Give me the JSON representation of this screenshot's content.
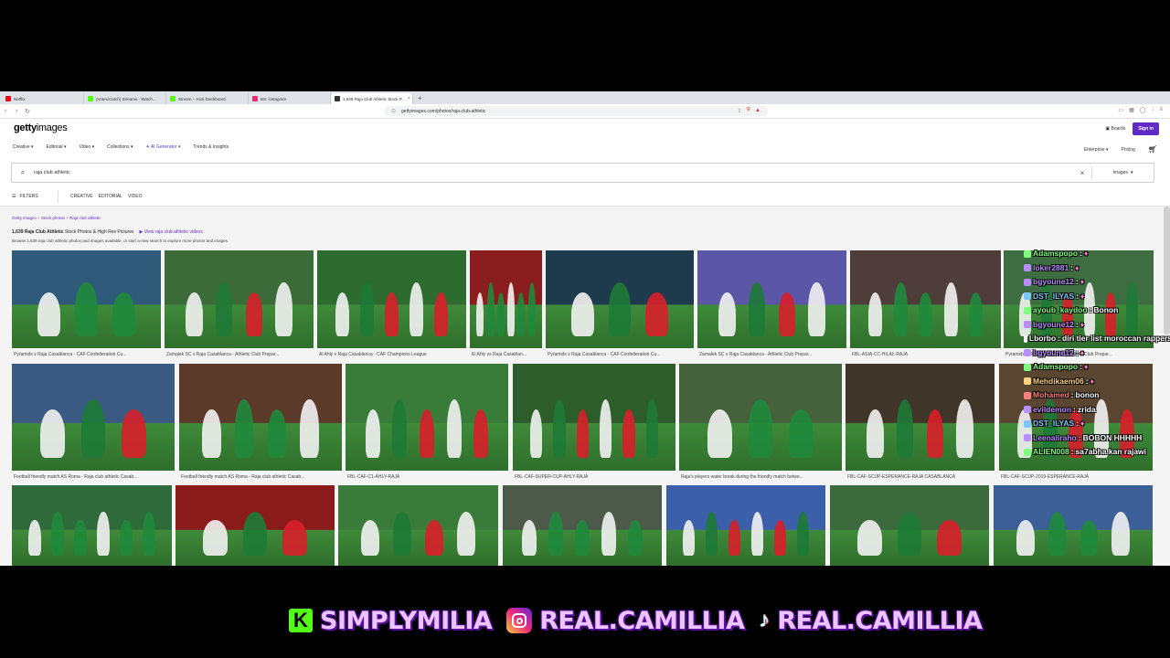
{
  "browser": {
    "tabs": [
      {
        "label": "Netflix",
        "color": "#e50914",
        "active": false
      },
      {
        "label": "(Votes/Catch) Streams - Watch...",
        "color": "#53fc18",
        "active": false
      },
      {
        "label": "Stream -- Kick Dashboard",
        "color": "#53fc18",
        "active": false
      },
      {
        "label": "BS: instagram",
        "color": "#e1306c",
        "active": false
      },
      {
        "label": "1,639 Raja Club Athletic Stock P...",
        "color": "#333333",
        "active": true
      }
    ],
    "url": "gettyimages.com/photos/raja-club-athletic"
  },
  "header": {
    "logo_bold": "getty",
    "logo_rest": "images",
    "nav": [
      "Creative",
      "Editorial",
      "Video",
      "Collections",
      "AI Generator",
      "Trends & Insights"
    ],
    "boards": "Boards",
    "signin": "Sign in",
    "enterprise": "Enterprise",
    "pricing": "Pricing"
  },
  "search": {
    "value": "raja club athletic",
    "scope": "Images"
  },
  "filters": {
    "label": "FILTERS",
    "tabs": [
      "CREATIVE",
      "EDITORIAL",
      "VIDEO"
    ]
  },
  "results": {
    "breadcrumb": [
      "Getty Images",
      "Stock photos",
      "Raja club athletic"
    ],
    "title_bold": "1,639 Raja Club Athletic",
    "title_rest": "Stock Photos & High Res Pictures",
    "video_link": "View raja club athletic videos",
    "subtitle": "Browse 1,639 raja club athletic photos and images available, or start a new search to explore more photos and images."
  },
  "images": [
    {
      "caption": "Pyramids v Raja Casablanca - CAF Confederation Cu...",
      "bg": "#2f5a7a"
    },
    {
      "caption": "Zamalek SC v Raja Casablanca - Athletic Club Prepar...",
      "bg": "#3c6b3a"
    },
    {
      "caption": "Al Ahly v Raja Casablanca - CAF Champions League",
      "bg": "#2e6b2f"
    },
    {
      "caption": "El Ahly vs Raja Casablan...",
      "bg": "#8a1d1d"
    },
    {
      "caption": "Pyramids v Raja Casablanca - CAF Confederation Cu...",
      "bg": "#1e3a4d"
    },
    {
      "caption": "Zamalek SC v Raja Casablanca - Athletic Club Prepar...",
      "bg": "#5b56a6"
    },
    {
      "caption": "FBL-ASIA-CC-HILAL-RAJA",
      "bg": "#4e3d3a"
    },
    {
      "caption": "Pyramids v Raja Casablanca - Athletic Club Prepar...",
      "bg": "#3e6d42"
    },
    {
      "caption": "Football friendly match AS Roma - Raja club athletic Casab...",
      "bg": "#3a5a82"
    },
    {
      "caption": "Football friendly match AS Roma - Raja club athletic Casab...",
      "bg": "#5b3a2a"
    },
    {
      "caption": "FBL-CAF-C1-AHLY-RAJA",
      "bg": "#397c3a"
    },
    {
      "caption": "FBL-CAF-SUPER-CUP-AHLY-RAJA",
      "bg": "#2d5d2a"
    },
    {
      "caption": "Raja's players water break during the friendly match betwe...",
      "bg": "#45623d"
    },
    {
      "caption": "FBL-CAF-SCUP-ESPERANCE-RAJA CASABLANCA",
      "bg": "#3f3528"
    },
    {
      "caption": "FBL-CAF-SCUP-2019-ESPERANCE-RAJA",
      "bg": "#5a4530"
    },
    {
      "caption": "",
      "bg": "#2f6a3a"
    },
    {
      "caption": "",
      "bg": "#8b1a1a"
    },
    {
      "caption": "",
      "bg": "#3a7a3a"
    },
    {
      "caption": "",
      "bg": "#4d5a4a"
    },
    {
      "caption": "",
      "bg": "#3b5fa8"
    },
    {
      "caption": "",
      "bg": "#3d6a3c"
    },
    {
      "caption": "",
      "bg": "#3b5f96"
    }
  ],
  "chat": [
    {
      "user": "Adamspopo",
      "text": "",
      "color": "#7fff7f"
    },
    {
      "user": "loker2881",
      "text": "",
      "color": "#b98cff"
    },
    {
      "user": "bgyoune12",
      "text": "",
      "color": "#b98cff"
    },
    {
      "user": "DST_ILYAS",
      "text": "",
      "color": "#7fc6ff"
    },
    {
      "user": "ayoub_kaydoo",
      "text": "Bonon",
      "color": "#7fff7f"
    },
    {
      "user": "bgyoune12",
      "text": "",
      "color": "#b98cff"
    },
    {
      "user": "Lborbo",
      "text": "diri tier list moroccan rappers",
      "color": "#ffffff"
    },
    {
      "user": "bgyoune12",
      "text": "",
      "color": "#b98cff"
    },
    {
      "user": "Adamspopo",
      "text": "",
      "color": "#7fff7f"
    },
    {
      "user": "Mehdikaem06",
      "text": "",
      "color": "#ffd27f"
    },
    {
      "user": "Mohamed",
      "text": "bonon",
      "color": "#ff7f7f"
    },
    {
      "user": "evildemon",
      "text": "zrida",
      "color": "#b98cff"
    },
    {
      "user": "DST_ILYAS",
      "text": "",
      "color": "#7fc6ff"
    },
    {
      "user": "Leenaliraho",
      "text": "BOBON HHHHH",
      "color": "#b98cff"
    },
    {
      "user": "ALIEN008",
      "text": "sa7abha kan rajawi",
      "color": "#7fff7f"
    }
  ],
  "banner": {
    "kick": "SIMPLYMILIA",
    "instagram": "REAL.CAMILLIA",
    "tiktok": "REAL.CAMILLIA"
  },
  "colors": {
    "accent": "#5e2cc4",
    "banner_text": "#ecc4ff",
    "banner_outline": "#5b0fa0",
    "kick_green": "#53fc18"
  }
}
